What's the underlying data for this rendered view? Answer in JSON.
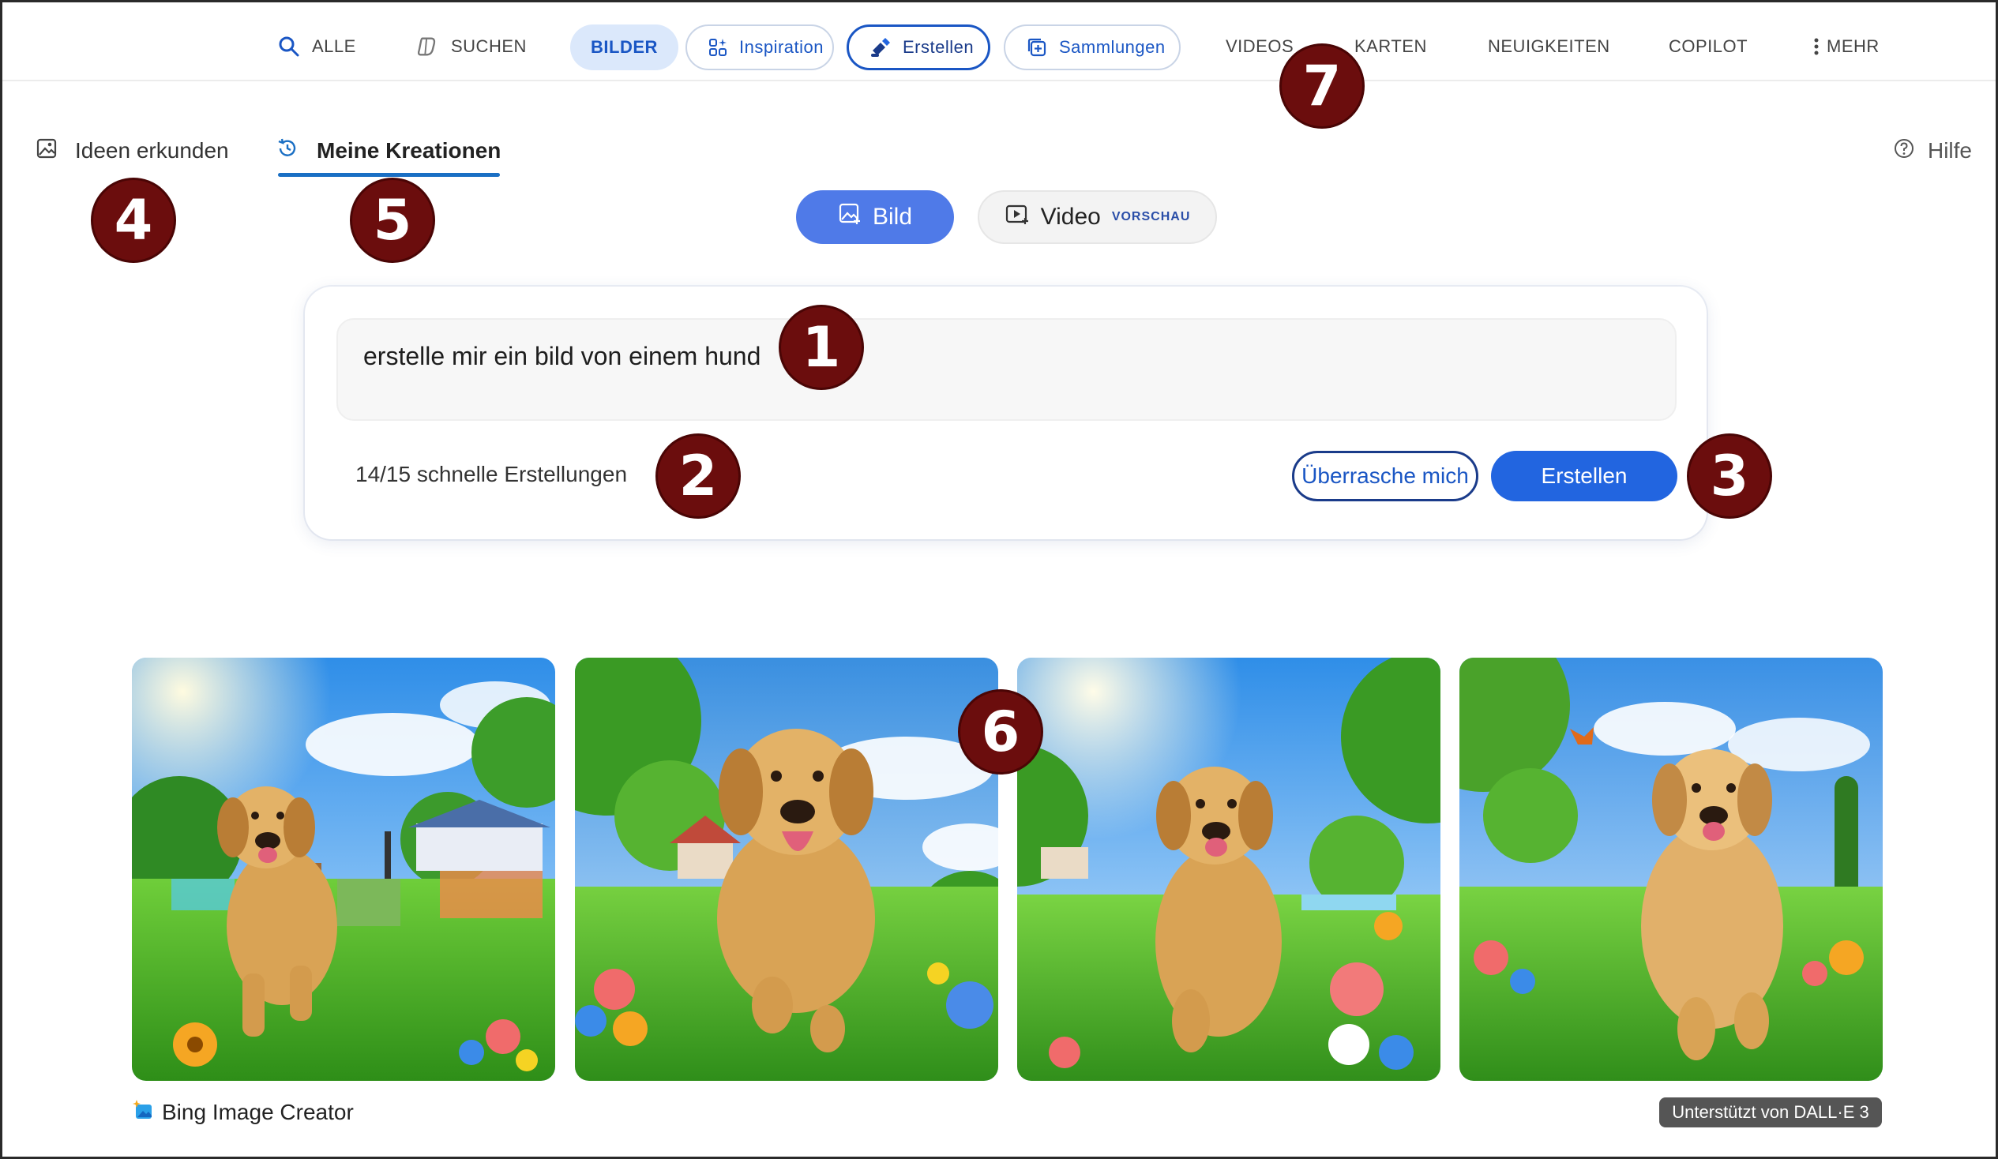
{
  "topnav": {
    "items": [
      {
        "label": "ALLE",
        "icon": "search-icon"
      },
      {
        "label": "SUCHEN",
        "icon": "copilot-search-icon"
      },
      {
        "label": "BILDER"
      },
      {
        "label": "Inspiration",
        "icon": "inspiration-icon"
      },
      {
        "label": "Erstellen",
        "icon": "create-brush-icon"
      },
      {
        "label": "Sammlungen",
        "icon": "collections-icon"
      },
      {
        "label": "VIDEOS"
      },
      {
        "label": "KARTEN"
      },
      {
        "label": "NEUIGKEITEN"
      },
      {
        "label": "COPILOT"
      },
      {
        "label": "MEHR",
        "icon": "more-vertical-icon"
      }
    ]
  },
  "subtabs": {
    "explore": "Ideen erkunden",
    "creations": "Meine Kreationen",
    "help": "Hilfe"
  },
  "mode": {
    "image": "Bild",
    "video": "Video",
    "video_badge": "VORSCHAU"
  },
  "prompt": {
    "value": "erstelle mir ein bild von einem hund",
    "quota": "14/15 schnelle Erstellungen",
    "surprise_label": "Überrasche mich",
    "create_label": "Erstellen"
  },
  "results": {
    "images": [
      {
        "alt": "golden retriever puppy running in park with playground"
      },
      {
        "alt": "golden retriever puppy running towards camera among flowers"
      },
      {
        "alt": "golden retriever running through sunny meadow with flowers"
      },
      {
        "alt": "golden retriever running in park with butterfly"
      }
    ]
  },
  "footer": {
    "brand": "Bing Image Creator",
    "powered": "Unterstützt von DALL·E 3"
  },
  "markers": [
    "1",
    "2",
    "3",
    "4",
    "5",
    "6",
    "7"
  ],
  "colors": {
    "accent": "#2265e0",
    "marker": "#6b0d0d",
    "active_pill": "#dbe8fb"
  }
}
